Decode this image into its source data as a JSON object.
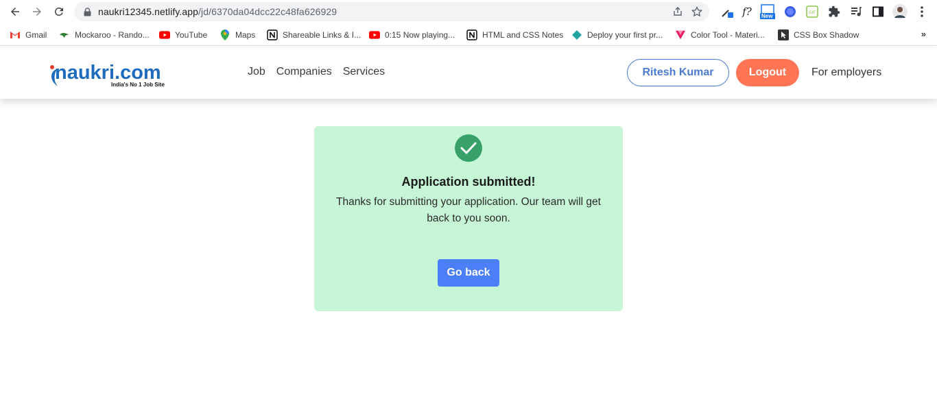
{
  "browser": {
    "url_host": "naukri12345.netlify.app",
    "url_path": "/jd/6370da04dcc22c48fa626929",
    "ext_new_badge": "New",
    "bookmarks": [
      {
        "label": "Gmail",
        "icon": "gmail-icon",
        "color": "#ea4335"
      },
      {
        "label": "Mockaroo - Rando...",
        "icon": "mockaroo-icon",
        "color": "#2e7d32"
      },
      {
        "label": "YouTube",
        "icon": "youtube-icon",
        "color": "#ff0000"
      },
      {
        "label": "Maps",
        "icon": "maps-icon",
        "color": "#34a853"
      },
      {
        "label": "Shareable Links & I...",
        "icon": "notion-icon",
        "color": "#000000"
      },
      {
        "label": "0:15 Now playing...",
        "icon": "youtube-icon",
        "color": "#ff0000"
      },
      {
        "label": "HTML and CSS Notes",
        "icon": "notion-icon",
        "color": "#000000"
      },
      {
        "label": "Deploy your first pr...",
        "icon": "diamond-icon",
        "color": "#1fa3a3"
      },
      {
        "label": "Color Tool - Materi...",
        "icon": "material-icon",
        "color": "#e91e63"
      },
      {
        "label": "CSS Box Shadow",
        "icon": "cursor-icon",
        "color": "#333333"
      }
    ],
    "more_label": "»"
  },
  "navbar": {
    "logo_text": "naukri.com",
    "logo_tagline": "India's No 1 Job Site",
    "links": [
      "Job",
      "Companies",
      "Services"
    ],
    "user_button": "Ritesh Kumar",
    "logout_button": "Logout",
    "employers_link": "For employers"
  },
  "card": {
    "title": "Application submitted!",
    "message": "Thanks for submitting your application. Our team will get back to you soon.",
    "back_button": "Go back"
  },
  "colors": {
    "card_bg": "#c6f6d5",
    "check_bg": "#38a169",
    "primary": "#4c7ef7",
    "logout": "#ff7555",
    "outline": "#4a7bd1"
  }
}
